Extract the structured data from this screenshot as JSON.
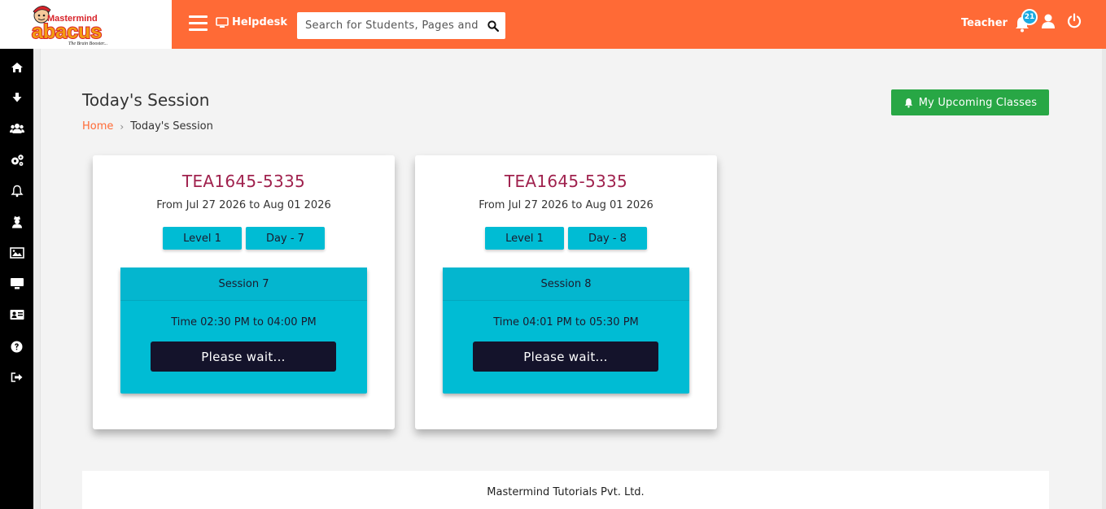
{
  "brand": {
    "line1": "Mastermind",
    "line2": "abacus",
    "tagline": "The Brain Booster...",
    "colors": {
      "red": "#d8232a",
      "orange": "#f39c12"
    }
  },
  "header": {
    "background": "#ff6a36",
    "helpdesk_label": "Helpdesk",
    "search_placeholder": "Search for Students, Pages and",
    "user_role": "Teacher",
    "notification_count": "21"
  },
  "sidebar": {
    "items": [
      {
        "name": "home",
        "icon": "home-icon"
      },
      {
        "name": "downloads",
        "icon": "arrow-down-icon"
      },
      {
        "name": "students",
        "icon": "users-icon"
      },
      {
        "name": "settings",
        "icon": "gears-icon"
      },
      {
        "name": "notifications",
        "icon": "bell-icon"
      },
      {
        "name": "teacher",
        "icon": "user-secret-icon"
      },
      {
        "name": "gallery",
        "icon": "image-icon"
      },
      {
        "name": "classes",
        "icon": "monitor-icon"
      },
      {
        "name": "id-card",
        "icon": "id-card-icon"
      },
      {
        "name": "help",
        "icon": "question-icon"
      },
      {
        "name": "logout",
        "icon": "sign-out-icon"
      }
    ]
  },
  "page": {
    "title": "Today's Session",
    "breadcrumb": {
      "home": "Home",
      "separator": "›",
      "current": "Today's Session"
    },
    "upcoming_button": "My Upcoming Classes"
  },
  "sessions": [
    {
      "code": "TEA1645-5335",
      "range": "From Jul 27 2026 to Aug 01 2026",
      "level": "Level 1",
      "day": "Day - 7",
      "session": "Session 7",
      "time": "Time 02:30 PM to 04:00 PM",
      "button": "Please wait..."
    },
    {
      "code": "TEA1645-5335",
      "range": "From Jul 27 2026 to Aug 01 2026",
      "level": "Level 1",
      "day": "Day - 8",
      "session": "Session 8",
      "time": "Time 04:01 PM to 05:30 PM",
      "button": "Please wait..."
    }
  ],
  "footer": {
    "text": "Mastermind Tutorials Pvt. Ltd."
  },
  "colors": {
    "accent": "#ff6a36",
    "card_title": "#a0224e",
    "session_bg": "#00bcd4",
    "button_dark": "#14132b",
    "success": "#28a745"
  }
}
